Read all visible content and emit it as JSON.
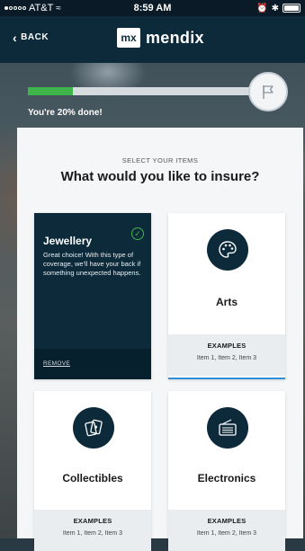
{
  "status_bar": {
    "carrier": "AT&T",
    "time": "8:59 AM",
    "signal_dots": [
      true,
      false,
      false,
      false,
      false
    ]
  },
  "nav": {
    "back_label": "BACK",
    "logo_mark": "mx",
    "logo_text": "mendix"
  },
  "progress": {
    "percent": 20,
    "label": "You're 20% done!"
  },
  "main": {
    "eyebrow": "SELECT YOUR ITEMS",
    "question": "What would you like to insure?"
  },
  "cards": [
    {
      "title": "Jewellery",
      "selected": true,
      "description": "Great choice! With this type of coverage, we'll have your back if something unexpected happens.",
      "remove_label": "REMOVE",
      "icon": "check-icon"
    },
    {
      "title": "Arts",
      "selected": false,
      "icon": "palette-icon",
      "examples_title": "EXAMPLES",
      "examples_items": "Item 1, Item 2, Item 3"
    },
    {
      "title": "Collectibles",
      "selected": false,
      "icon": "playing-cards-icon",
      "examples_title": "EXAMPLES",
      "examples_items": "Item 1, Item 2, Item 3"
    },
    {
      "title": "Electronics",
      "selected": false,
      "icon": "radio-icon",
      "examples_title": "EXAMPLES",
      "examples_items": "Item 1, Item 2, Item 3"
    }
  ],
  "colors": {
    "navy": "#0c2a3a",
    "green": "#3db54a",
    "blue_accent": "#2f8fd8",
    "panel_bg": "#f4f6f8"
  }
}
